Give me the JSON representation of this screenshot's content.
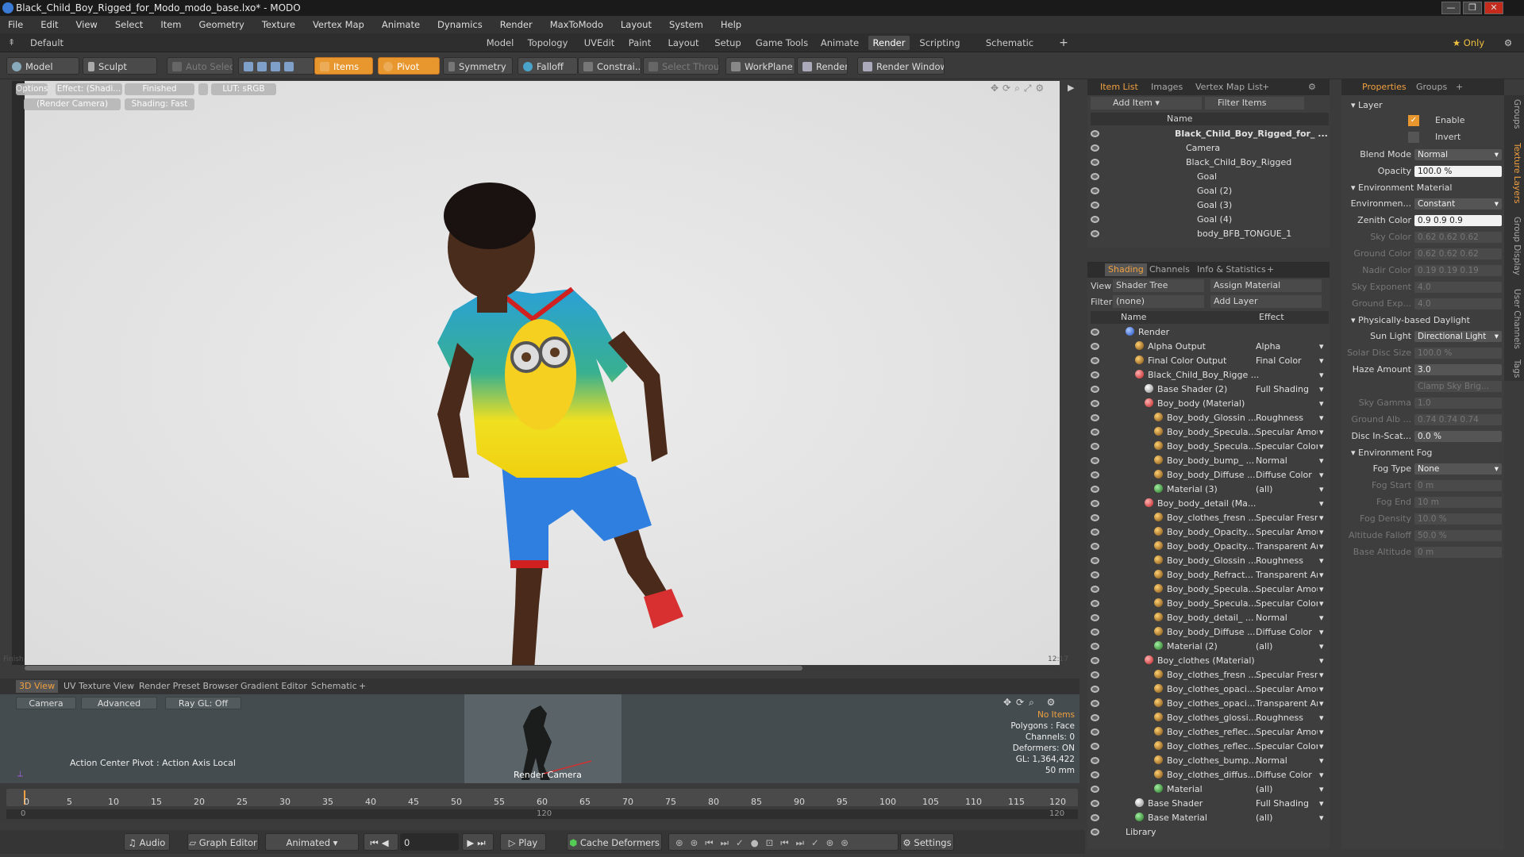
{
  "window": {
    "title": "Black_Child_Boy_Rigged_for_Modo_modo_base.lxo* - MODO",
    "controls": [
      "—",
      "❐",
      "✕"
    ]
  },
  "menu": [
    "File",
    "Edit",
    "View",
    "Select",
    "Item",
    "Geometry",
    "Texture",
    "Vertex Map",
    "Animate",
    "Dynamics",
    "Render",
    "MaxToModo",
    "Layout",
    "System",
    "Help"
  ],
  "layoutbar": {
    "layouts": "Default Layouts ▾",
    "tabs": [
      "Model",
      "Topology",
      "UVEdit",
      "Paint",
      "Layout",
      "Setup",
      "Game Tools",
      "Animate",
      "Render",
      "Scripting",
      "Schematic Fusion"
    ],
    "active": "Render",
    "plus": "+",
    "only": "★ Only"
  },
  "toolbar": {
    "model": "Model",
    "sculpt": "Sculpt",
    "auto_select": "Auto Select",
    "items": "Items",
    "pivot": "Pivot",
    "symmetry": "Symmetry",
    "falloff": "Falloff",
    "constraints": "Constrai...",
    "select_through": "Select Through",
    "workplane": "WorkPlane",
    "render": "Render",
    "render_window": "Render Window"
  },
  "viewport": {
    "options": "Options",
    "effect": "Effect: (Shadi...",
    "finished": "Finished",
    "lut": "LUT: sRGB",
    "render_camera": "(Render Camera)",
    "shading": "Shading: Fast",
    "status_left": "Finish",
    "status_right": "12:17"
  },
  "bottom_tabs": [
    "3D View",
    "UV Texture View",
    "Render Preset Browser",
    "Gradient Editor",
    "Schematic",
    "+"
  ],
  "bottom_view": {
    "camera": "Camera",
    "advanced": "Advanced",
    "raygl": "Ray GL: Off",
    "action_center": "Action Center Pivot : Action Axis Local",
    "cam_label": "Render Camera",
    "stats": [
      "No Items",
      "Polygons : Face",
      "Channels: 0",
      "Deformers: ON",
      "GL: 1,364,422",
      "50 mm"
    ]
  },
  "timeline": {
    "ticks": [
      "0",
      "5",
      "10",
      "15",
      "20",
      "25",
      "30",
      "35",
      "40",
      "45",
      "50",
      "55",
      "60",
      "65",
      "70",
      "75",
      "80",
      "85",
      "90",
      "95",
      "100",
      "105",
      "110",
      "115",
      "120"
    ],
    "sub_left": "0",
    "sub_mid": "120",
    "sub_right": "120"
  },
  "transport": {
    "audio": "Audio",
    "graph_editor": "Graph Editor",
    "animated": "Animated",
    "frame": "0",
    "play": "Play",
    "cache": "Cache Deformers",
    "settings": "Settings"
  },
  "itemlist": {
    "tabs": [
      "Item List",
      "Images",
      "Vertex Map List",
      "+"
    ],
    "add_item": "Add Item",
    "filter": "Filter Items",
    "col_name": "Name",
    "rows": [
      {
        "label": "Black_Child_Boy_Rigged_for_ ...",
        "indent": 0,
        "bold": true
      },
      {
        "label": "Camera",
        "indent": 1
      },
      {
        "label": "Black_Child_Boy_Rigged",
        "indent": 1
      },
      {
        "label": "Goal",
        "indent": 2
      },
      {
        "label": "Goal (2)",
        "indent": 2
      },
      {
        "label": "Goal (3)",
        "indent": 2
      },
      {
        "label": "Goal (4)",
        "indent": 2
      },
      {
        "label": "body_BFB_TONGUE_1",
        "indent": 2
      }
    ]
  },
  "shading": {
    "tabs": [
      "Shading",
      "Channels",
      "Info & Statistics",
      "+"
    ],
    "view_label": "View",
    "view_value": "Shader Tree",
    "assign": "Assign Material",
    "filter_label": "Filter",
    "filter_value": "(none)",
    "add_layer": "Add Layer",
    "col_name": "Name",
    "col_effect": "Effect",
    "rows": [
      {
        "n": "Render",
        "e": "",
        "i": 0,
        "b": "blue"
      },
      {
        "n": "Alpha Output",
        "e": "Alpha",
        "i": 1,
        "b": "tex"
      },
      {
        "n": "Final Color Output",
        "e": "Final Color",
        "i": 1,
        "b": "tex"
      },
      {
        "n": "Black_Child_Boy_Rigge ...",
        "e": "",
        "i": 1,
        "b": "mat"
      },
      {
        "n": "Base Shader (2)",
        "e": "Full Shading",
        "i": 2,
        "b": "sh"
      },
      {
        "n": "Boy_body (Material)",
        "e": "",
        "i": 2,
        "b": "mat"
      },
      {
        "n": "Boy_body_Glossin ...",
        "e": "Roughness",
        "i": 3,
        "b": "tex"
      },
      {
        "n": "Boy_body_Specula...",
        "e": "Specular Amount",
        "i": 3,
        "b": "tex"
      },
      {
        "n": "Boy_body_Specula...",
        "e": "Specular Color",
        "i": 3,
        "b": "tex"
      },
      {
        "n": "Boy_body_bump_ ...",
        "e": "Normal",
        "i": 3,
        "b": "tex"
      },
      {
        "n": "Boy_body_Diffuse ...",
        "e": "Diffuse Color",
        "i": 3,
        "b": "tex"
      },
      {
        "n": "Material (3)",
        "e": "(all)",
        "i": 3,
        "b": "grn"
      },
      {
        "n": "Boy_body_detail (Ma...",
        "e": "",
        "i": 2,
        "b": "mat"
      },
      {
        "n": "Boy_clothes_fresn ...",
        "e": "Specular Fresnel",
        "i": 3,
        "b": "tex"
      },
      {
        "n": "Boy_body_Opacity...",
        "e": "Specular Amount",
        "i": 3,
        "b": "tex"
      },
      {
        "n": "Boy_body_Opacity...",
        "e": "Transparent Am...",
        "i": 3,
        "b": "tex"
      },
      {
        "n": "Boy_body_Glossin ...",
        "e": "Roughness",
        "i": 3,
        "b": "tex"
      },
      {
        "n": "Boy_body_Refract...",
        "e": "Transparent Am...",
        "i": 3,
        "b": "tex"
      },
      {
        "n": "Boy_body_Specula...",
        "e": "Specular Amount",
        "i": 3,
        "b": "tex"
      },
      {
        "n": "Boy_body_Specula...",
        "e": "Specular Color",
        "i": 3,
        "b": "tex"
      },
      {
        "n": "Boy_body_detail_ ...",
        "e": "Normal",
        "i": 3,
        "b": "tex"
      },
      {
        "n": "Boy_body_Diffuse ...",
        "e": "Diffuse Color",
        "i": 3,
        "b": "tex"
      },
      {
        "n": "Material (2)",
        "e": "(all)",
        "i": 3,
        "b": "grn"
      },
      {
        "n": "Boy_clothes (Material)",
        "e": "",
        "i": 2,
        "b": "mat"
      },
      {
        "n": "Boy_clothes_fresn ...",
        "e": "Specular Fresnel",
        "i": 3,
        "b": "tex"
      },
      {
        "n": "Boy_clothes_opaci...",
        "e": "Specular Amount",
        "i": 3,
        "b": "tex"
      },
      {
        "n": "Boy_clothes_opaci...",
        "e": "Transparent Am...",
        "i": 3,
        "b": "tex"
      },
      {
        "n": "Boy_clothes_glossi...",
        "e": "Roughness",
        "i": 3,
        "b": "tex"
      },
      {
        "n": "Boy_clothes_reflec...",
        "e": "Specular Amount",
        "i": 3,
        "b": "tex"
      },
      {
        "n": "Boy_clothes_reflec...",
        "e": "Specular Color",
        "i": 3,
        "b": "tex"
      },
      {
        "n": "Boy_clothes_bump...",
        "e": "Normal",
        "i": 3,
        "b": "tex"
      },
      {
        "n": "Boy_clothes_diffus...",
        "e": "Diffuse Color",
        "i": 3,
        "b": "tex"
      },
      {
        "n": "Material",
        "e": "(all)",
        "i": 3,
        "b": "grn"
      },
      {
        "n": "Base Shader",
        "e": "Full Shading",
        "i": 1,
        "b": "sh"
      },
      {
        "n": "Base Material",
        "e": "(all)",
        "i": 1,
        "b": "grn"
      },
      {
        "n": "Library",
        "e": "",
        "i": 0,
        "b": ""
      }
    ]
  },
  "properties": {
    "tabs": [
      "Properties",
      "Groups",
      "+"
    ],
    "layer": "Layer",
    "enable": "Enable",
    "invert": "Invert",
    "blend_mode": {
      "label": "Blend Mode",
      "value": "Normal"
    },
    "opacity": {
      "label": "Opacity",
      "value": "100.0 %"
    },
    "env_material": "Environment Material",
    "fields": [
      {
        "l": "Environmen...",
        "v": "Constant",
        "dim": false,
        "t": "drop"
      },
      {
        "l": "Zenith Color",
        "v": "0.9   0.9   0.9",
        "dim": false,
        "t": "white"
      },
      {
        "l": "Sky Color",
        "v": "0.62  0.62  0.62",
        "dim": true
      },
      {
        "l": "Ground Color",
        "v": "0.62  0.62  0.62",
        "dim": true
      },
      {
        "l": "Nadir Color",
        "v": "0.19  0.19  0.19",
        "dim": true
      },
      {
        "l": "Sky Exponent",
        "v": "4.0",
        "dim": true
      },
      {
        "l": "Ground Exp...",
        "v": "4.0",
        "dim": true
      }
    ],
    "daylight": "Physically-based Daylight",
    "fields2": [
      {
        "l": "Sun Light",
        "v": "Directional Light",
        "dim": false,
        "t": "drop"
      },
      {
        "l": "Solar Disc Size",
        "v": "100.0 %",
        "dim": true
      },
      {
        "l": "Haze Amount",
        "v": "3.0",
        "dim": false
      },
      {
        "l": "",
        "v": "Clamp Sky Brig...",
        "dim": true
      },
      {
        "l": "Sky Gamma",
        "v": "1.0",
        "dim": true
      },
      {
        "l": "Ground Alb ...",
        "v": "0.74  0.74  0.74",
        "dim": true
      },
      {
        "l": "Disc In-Scat...",
        "v": "0.0 %",
        "dim": false
      }
    ],
    "fog": "Environment Fog",
    "fields3": [
      {
        "l": "Fog Type",
        "v": "None",
        "dim": false,
        "t": "drop"
      },
      {
        "l": "Fog Start",
        "v": "0 m",
        "dim": true
      },
      {
        "l": "Fog End",
        "v": "10 m",
        "dim": true
      },
      {
        "l": "Fog Density",
        "v": "10.0 %",
        "dim": true
      },
      {
        "l": "Altitude Falloff",
        "v": "50.0 %",
        "dim": true
      },
      {
        "l": "Base Altitude",
        "v": "0 m",
        "dim": true
      }
    ],
    "side_tabs": [
      "Groups",
      "Texture Layers",
      "Group Display",
      "User Channels",
      "Tags"
    ]
  }
}
